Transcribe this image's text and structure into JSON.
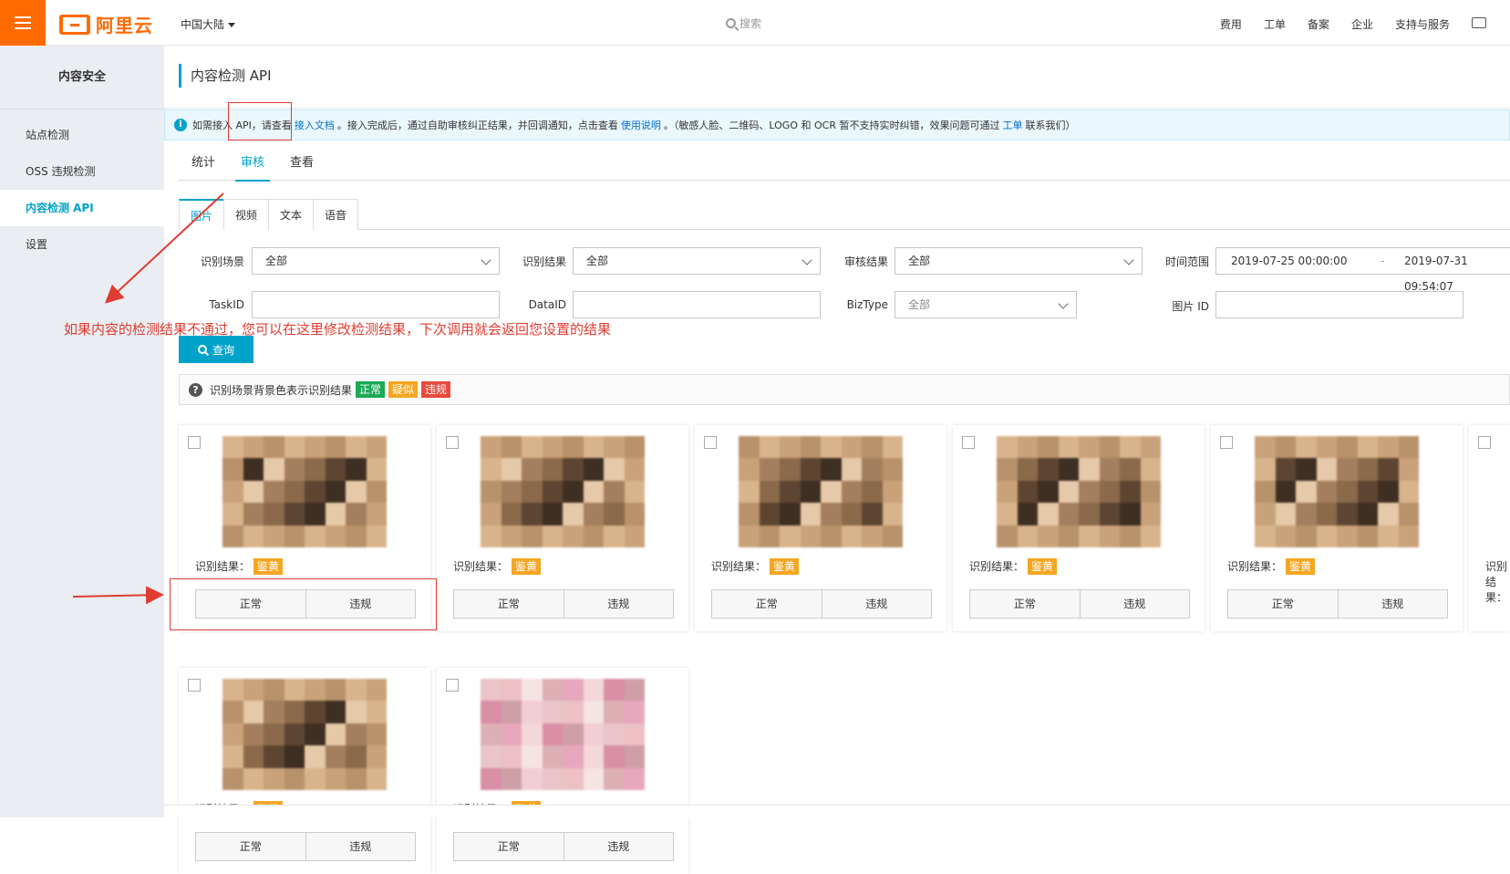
{
  "topbar": {
    "logo_text": "阿里云",
    "region": "中国大陆",
    "search_placeholder": "搜索",
    "links": [
      "费用",
      "工单",
      "备案",
      "企业",
      "支持与服务"
    ]
  },
  "sidebar": {
    "title": "内容安全",
    "items": [
      {
        "label": "站点检测"
      },
      {
        "label": "OSS 违规检测"
      },
      {
        "label": "内容检测 API"
      },
      {
        "label": "设置"
      }
    ]
  },
  "page": {
    "title": "内容检测 API",
    "notice": {
      "p1": "如需接入 API，请查看",
      "link1": "接入文档",
      "p2": "。接入完成后，通过自助审核纠正结果，并回调通知，点击查看",
      "link2": "使用说明",
      "p3": "。（敏感人脸、二维码、LOGO 和 OCR 暂不支持实时纠错，效果问题可通过",
      "link3": "工单",
      "p4": "联系我们）"
    },
    "tabs": [
      "统计",
      "审核",
      "查看"
    ],
    "subtabs": [
      "图片",
      "视频",
      "文本",
      "语音"
    ]
  },
  "filters": {
    "scene_label": "识别场景",
    "scene_value": "全部",
    "result_label": "识别结果",
    "result_value": "全部",
    "audit_label": "审核结果",
    "audit_value": "全部",
    "time_label": "时间范围",
    "time_start": "2019-07-25 00:00:00",
    "time_sep": "-",
    "time_end": "2019-07-31 09:54:07",
    "taskid_label": "TaskID",
    "dataid_label": "DataID",
    "biztype_label": "BizType",
    "biztype_value": "全部",
    "imageid_label": "图片 ID",
    "query_label": "查询"
  },
  "legend": {
    "text": "识别场景背景色表示识别结果",
    "normal": "正常",
    "suspect": "疑似",
    "violation": "违规",
    "colors": {
      "normal": "#1aaa55",
      "suspect": "#f5a623",
      "violation": "#e64a3b"
    }
  },
  "annotation": "如果内容的检测结果不通过，您可以在这里修改检测结果，下次调用就会返回您设置的结果",
  "cards": {
    "result_label": "识别结果：",
    "result_value": "鉴黄",
    "btn_normal": "正常",
    "btn_violation": "违规"
  }
}
